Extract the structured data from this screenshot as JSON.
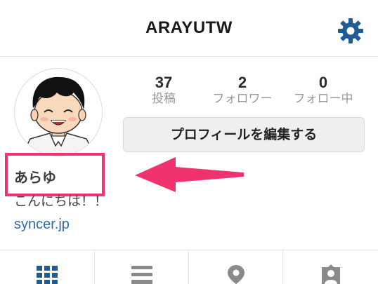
{
  "header": {
    "title": "ARAYUTW"
  },
  "stats": [
    {
      "value": "37",
      "label": "投稿"
    },
    {
      "value": "2",
      "label": "フォロワー"
    },
    {
      "value": "0",
      "label": "フォロー中"
    }
  ],
  "edit_button": {
    "label": "プロフィールを編集する"
  },
  "profile": {
    "name": "あらゆ",
    "bio": "こんにちは！！",
    "link": "syncer.jp"
  },
  "tabs": [
    {
      "icon": "grid-icon"
    },
    {
      "icon": "list-icon"
    },
    {
      "icon": "location-pin-icon"
    },
    {
      "icon": "tagged-person-icon"
    }
  ],
  "colors": {
    "accent_blue": "#2f6aa5",
    "highlight_pink": "#f0336e"
  }
}
